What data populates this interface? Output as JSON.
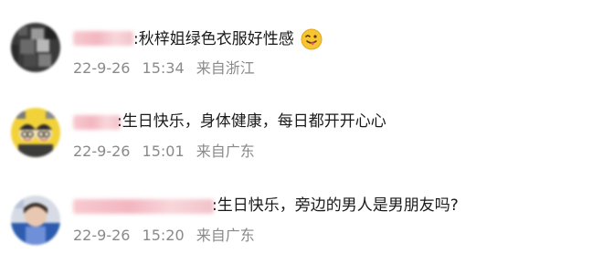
{
  "comments": [
    {
      "text": ":秋梓姐绿色衣服好性感",
      "emoji": "tongue-out-wink-emoji",
      "date": "22-9-26",
      "time": "15:34",
      "location": "来自浙江"
    },
    {
      "text": ":生日快乐，身体健康，每日都开开心心",
      "date": "22-9-26",
      "time": "15:01",
      "location": "来自广东"
    },
    {
      "text": ":生日快乐，旁边的男人是男朋友吗?",
      "date": "22-9-26",
      "time": "15:20",
      "location": "来自广东"
    }
  ],
  "colors": {
    "text": "#1a1a1a",
    "meta": "#8a8a8a",
    "name_blur": "#f3b6c0",
    "background": "#ffffff"
  }
}
